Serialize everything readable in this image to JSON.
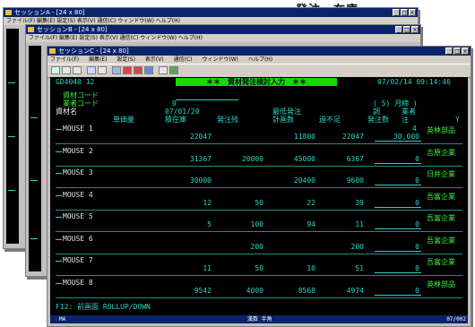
{
  "caption": "発注、在庫",
  "back_windows": [
    {
      "title": "セッションA - [24 x 80]",
      "menu": "ファイル(F)  編集(E)  設定(S)  表示(V)  通信(C)  ウィンドウ(W)  ヘルプ(H)"
    },
    {
      "title": "セッションB - [24 x 80]",
      "menu": "ファイル(F)  編集(E)  設定(S)  表示(V)  通信(C)  ウィンドウ(W)  ヘルプ(H)"
    }
  ],
  "main_window": {
    "title": "セッションC - [24 x 80]",
    "menu": [
      "ファイル(F)",
      "編集(E)",
      "設定(S)",
      "表示(V)",
      "通信(C)",
      "ウィンドウ(W)",
      "ヘルプ(H)"
    ]
  },
  "terminal": {
    "program_id": "GD4040 12",
    "screen_title": "＊＊　資材発注検討入力　＊＊",
    "date_time": "07/02/14  09:14:46",
    "field1_label": "資材コード",
    "field2_label": "業者コード",
    "field2_value": "0",
    "period": "( 5) 月締 )",
    "col_header_row1": {
      "item_name": "資材名",
      "date": "07/01/20",
      "recent_order": "最低発注",
      "adj": "調",
      "vendor": "業者"
    },
    "col_header_row2": {
      "unit_price": "単価量",
      "stock": "積在庫",
      "ordered": "発注残",
      "planned": "計画数",
      "shortage": "過不足",
      "order_qty": "発注数",
      "vendor_code": "注",
      "y": "Y"
    },
    "rows": [
      {
        "name": "MOUSE 1",
        "stock": "22047",
        "ordered": "",
        "planned": "11800",
        "shortage": "22047",
        "order_qty": "30,000",
        "flag": "4",
        "vendor": "英林部品"
      },
      {
        "name": "MOUSE 2",
        "stock": "31367",
        "ordered": "20000",
        "planned": "45000",
        "shortage": "6367",
        "order_qty": "0",
        "flag": "",
        "vendor": "吉原企業"
      },
      {
        "name": "MOUSE 3",
        "stock": "30000",
        "ordered": "",
        "planned": "20400",
        "shortage": "9600",
        "order_qty": "0",
        "flag": "",
        "vendor": "日井企業"
      },
      {
        "name": "MOUSE 4",
        "stock": "12",
        "ordered": "50",
        "planned": "22",
        "shortage": "39",
        "order_qty": "0",
        "flag": "",
        "vendor": "吾富企業"
      },
      {
        "name": "MOUSE 5",
        "stock": "5",
        "ordered": "100",
        "planned": "94",
        "shortage": "11",
        "order_qty": "0",
        "flag": "",
        "vendor": "吾富企業"
      },
      {
        "name": "MOUSE 6",
        "stock": "",
        "ordered": "200",
        "planned": "",
        "shortage": "200",
        "order_qty": "0",
        "flag": "",
        "vendor": "吾富企業"
      },
      {
        "name": "MOUSE 7",
        "stock": "11",
        "ordered": "50",
        "planned": "10",
        "shortage": "51",
        "order_qty": "0",
        "flag": "",
        "vendor": "吾富企業"
      },
      {
        "name": "MOUSE 8",
        "stock": "9542",
        "ordered": "4000",
        "planned": "8568",
        "shortage": "4974",
        "order_qty": "0",
        "flag": "",
        "vendor": "英林部品"
      }
    ],
    "fkeys": "F12: 前画面   ROLLUP/DOWN",
    "status_left": "MA",
    "status_mid": "漢数  半角",
    "status_right": "07/002"
  },
  "colors": {
    "title_bar": "#0a246a",
    "terminal_bg": "#000000",
    "terminal_text": "#27d6c3",
    "title_highlight": "#12d912"
  },
  "icons": [
    "app-icon",
    "minimize-icon",
    "maximize-icon",
    "close-icon",
    "connect-icon",
    "disconnect-icon",
    "print-icon",
    "copy-icon",
    "paste-icon",
    "macro-icon",
    "record-icon",
    "stop-icon",
    "play-icon",
    "settings-icon",
    "help-icon"
  ]
}
